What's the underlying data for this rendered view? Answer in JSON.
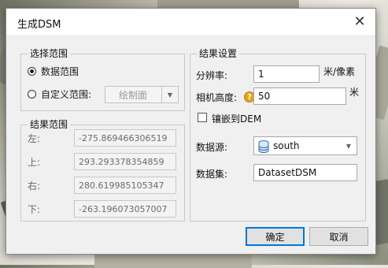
{
  "dialog": {
    "title": "生成DSM",
    "close_glyph": "✕"
  },
  "selection": {
    "group_title": "选择范围",
    "option_data_range": "数据范围",
    "option_custom_range": "自定义范围:",
    "draw_button": "绘制面",
    "selected": "数据范围"
  },
  "result_range": {
    "group_title": "结果范围",
    "left_label": "左:",
    "left_value": "-275.869466306519",
    "top_label": "上:",
    "top_value": "293.293378354859",
    "right_label": "右:",
    "right_value": "280.619985105347",
    "bottom_label": "下:",
    "bottom_value": "-263.196073057007"
  },
  "settings": {
    "group_title": "结果设置",
    "resolution_label": "分辨率:",
    "resolution_value": "1",
    "resolution_unit": "米/像素",
    "camera_height_label": "相机高度:",
    "camera_height_value": "50",
    "camera_height_unit": "米",
    "embed_dem_label": "镶嵌到DEM",
    "embed_dem_checked": false,
    "datasource_label": "数据源:",
    "datasource_value": "south",
    "dataset_label": "数据集:",
    "dataset_value": "DatasetDSM"
  },
  "buttons": {
    "ok": "确定",
    "cancel": "取消"
  },
  "icons": {
    "close": "close-icon",
    "help": "help-icon",
    "datasource": "database-icon",
    "dropdown": "chevron-down-icon"
  }
}
